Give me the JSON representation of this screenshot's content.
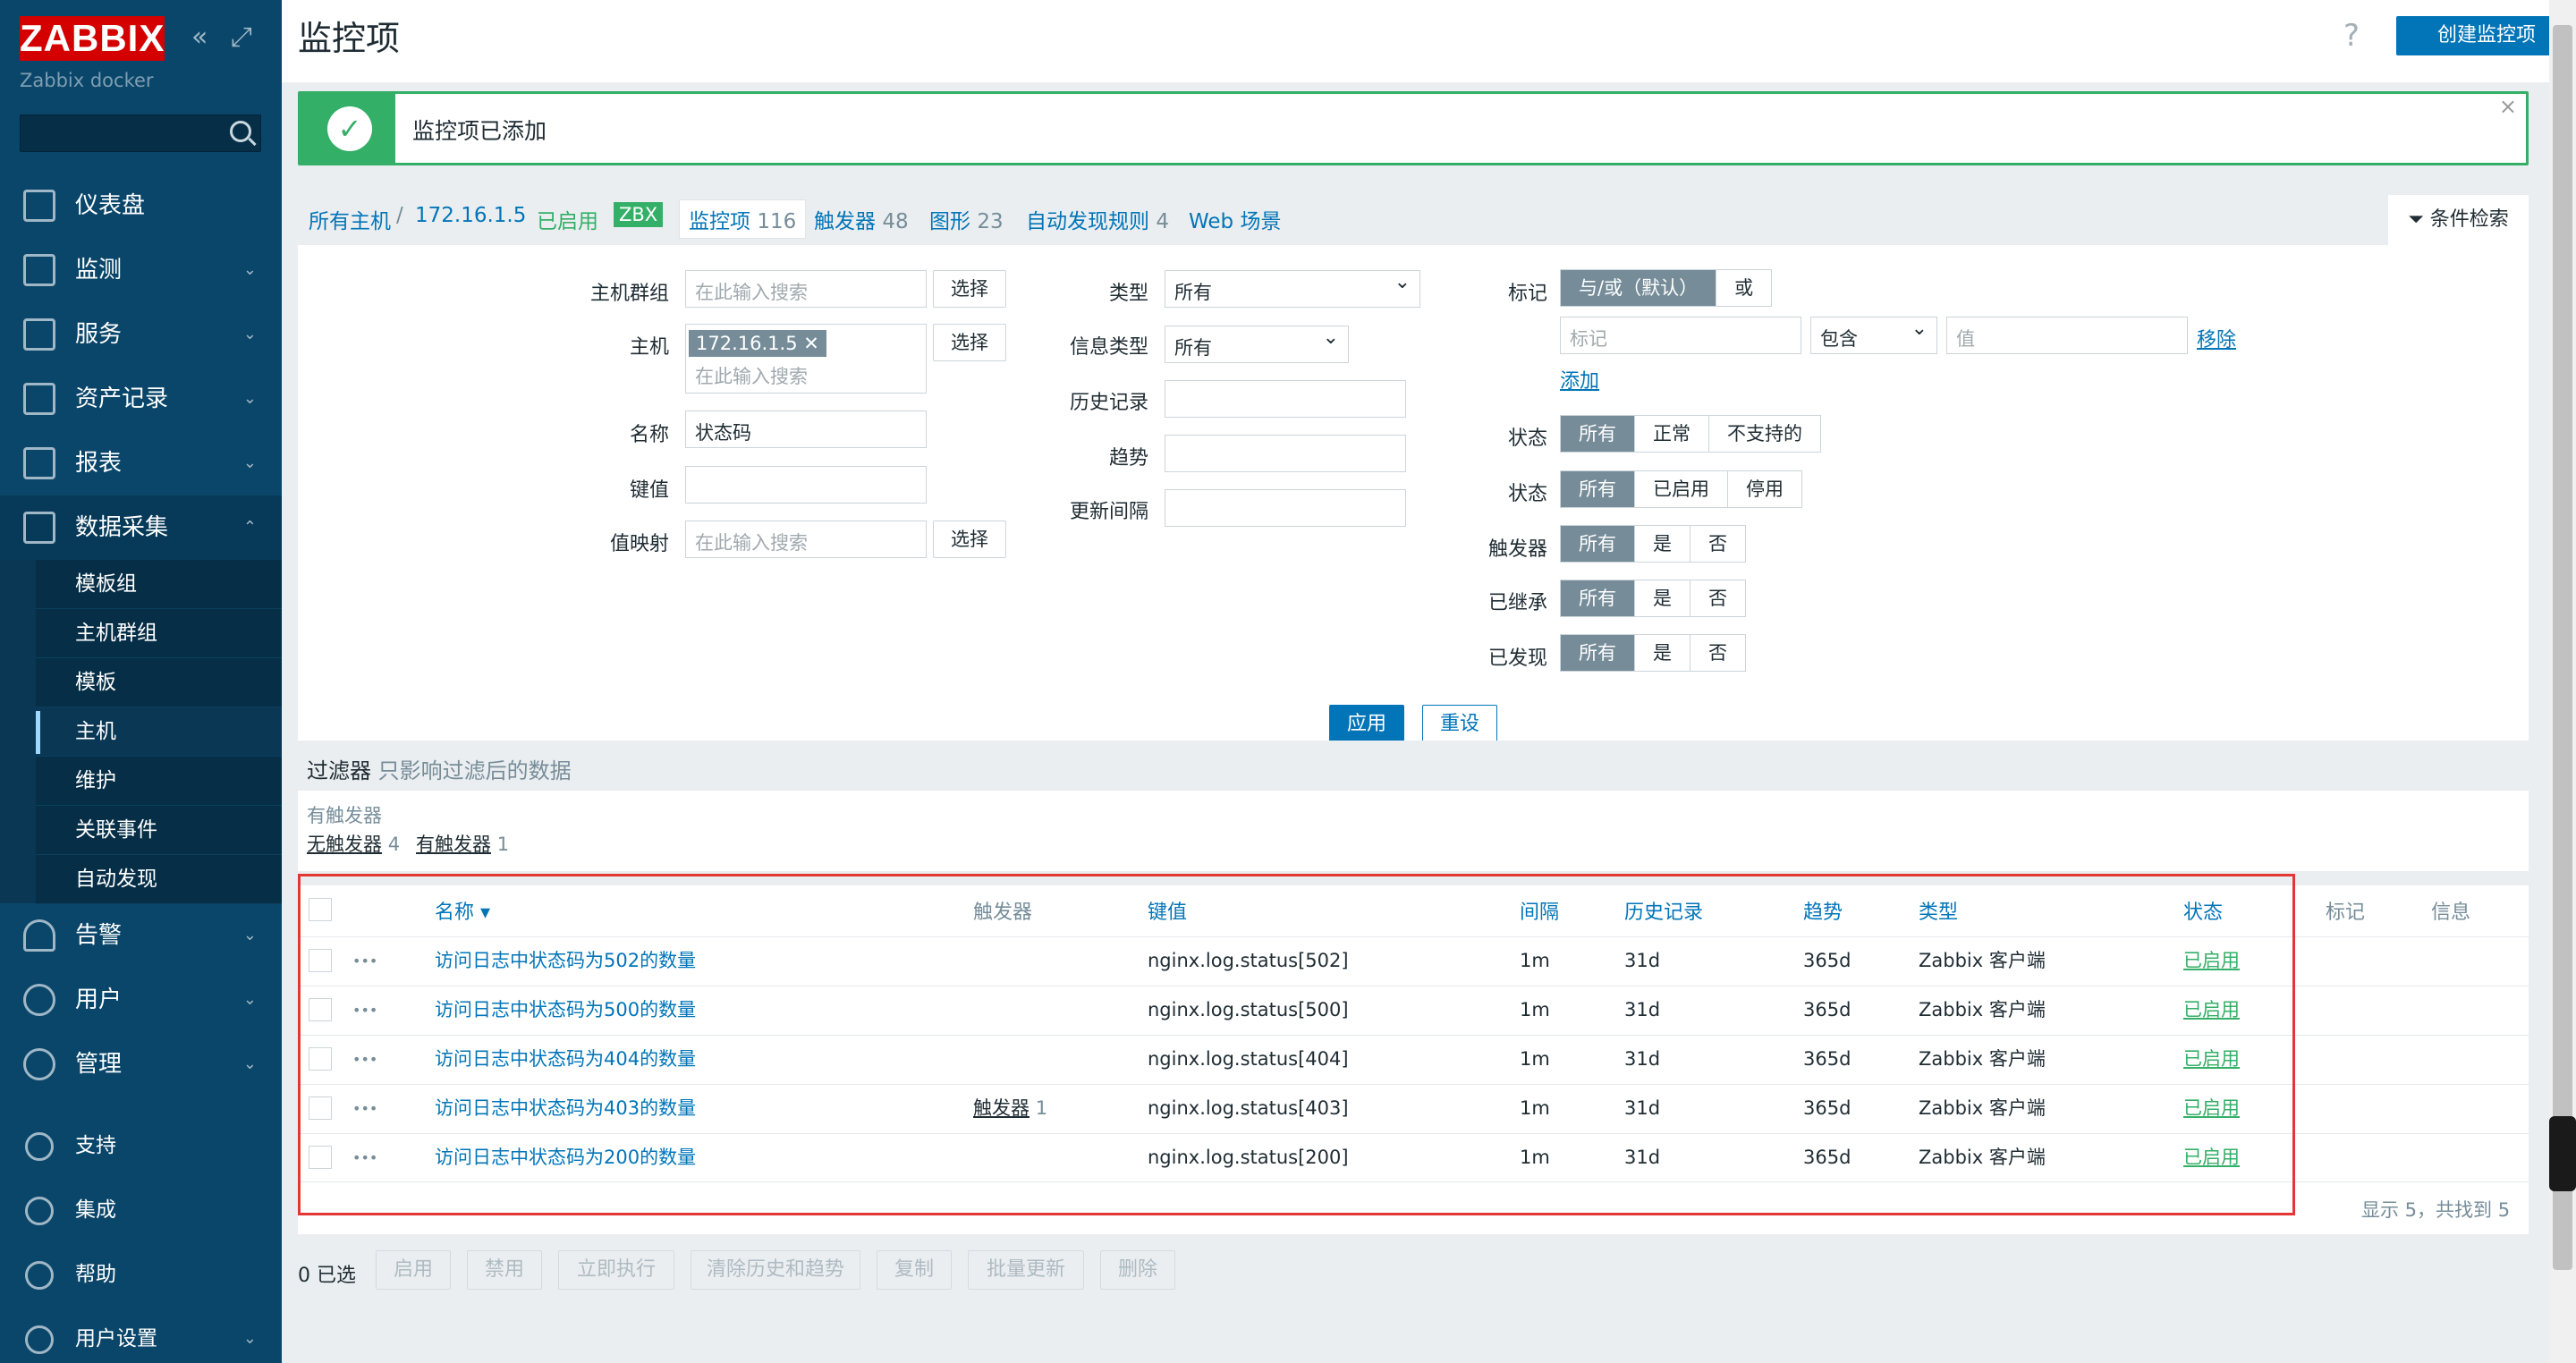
{
  "brand": {
    "logo": "ZABBIX",
    "subtitle": "Zabbix docker"
  },
  "sidebar": {
    "nav": [
      {
        "label": "仪表盘",
        "icon": "dashboard-icon"
      },
      {
        "label": "监测",
        "icon": "monitoring-icon"
      },
      {
        "label": "服务",
        "icon": "services-icon"
      },
      {
        "label": "资产记录",
        "icon": "inventory-icon"
      },
      {
        "label": "报表",
        "icon": "reports-icon"
      },
      {
        "label": "数据采集",
        "icon": "data-collection-icon"
      }
    ],
    "sub": [
      "模板组",
      "主机群组",
      "模板",
      "主机",
      "维护",
      "关联事件",
      "自动发现"
    ],
    "nav_bottom": [
      {
        "label": "告警"
      },
      {
        "label": "用户"
      },
      {
        "label": "管理"
      }
    ],
    "footer": [
      {
        "label": "支持"
      },
      {
        "label": "集成"
      },
      {
        "label": "帮助"
      },
      {
        "label": "用户设置"
      }
    ]
  },
  "header": {
    "title": "监控项",
    "help": "?",
    "create": "创建监控项"
  },
  "message": {
    "text": "监控项已添加"
  },
  "tabs": {
    "all_hosts": "所有主机",
    "sep": "/",
    "host": "172.16.1.5",
    "enabled": "已启用",
    "zbx": "ZBX",
    "items": "监控项",
    "items_count": "116",
    "triggers": "触发器",
    "triggers_count": "48",
    "graphs": "图形",
    "graphs_count": "23",
    "discovery": "自动发现规则",
    "discovery_count": "4",
    "web": "Web 场景",
    "filter_tab": "条件检索"
  },
  "filter": {
    "host_group_label": "主机群组",
    "host_group_ph": "在此输入搜索",
    "select": "选择",
    "host_label": "主机",
    "host_chip": "172.16.1.5",
    "host_ph": "在此输入搜索",
    "name_label": "名称",
    "name_value": "状态码",
    "key_label": "键值",
    "valuemap_label": "值映射",
    "valuemap_ph": "在此输入搜索",
    "type_label": "类型",
    "type_value": "所有",
    "infotype_label": "信息类型",
    "infotype_value": "所有",
    "history_label": "历史记录",
    "trends_label": "趋势",
    "interval_label": "更新间隔",
    "tags_label": "标记",
    "andor": "与/或（默认）",
    "or": "或",
    "tag_ph": "标记",
    "contains": "包含",
    "value_ph": "值",
    "remove": "移除",
    "add": "添加",
    "state_label": "状态",
    "state": [
      "所有",
      "正常",
      "不支持的"
    ],
    "status_label": "状态",
    "status": [
      "所有",
      "已启用",
      "停用"
    ],
    "triggers_label": "触发器",
    "inherited_label": "已继承",
    "discovered_label": "已发现",
    "yn": [
      "所有",
      "是",
      "否"
    ],
    "apply": "应用",
    "reset": "重设"
  },
  "subfilter": {
    "title": "过滤器",
    "hint": "只影响过滤后的数据",
    "group": "有触发器",
    "no_trig": "无触发器",
    "no_trig_n": "4",
    "has_trig": "有触发器",
    "has_trig_n": "1"
  },
  "table": {
    "headers": {
      "name": "名称 ▾",
      "triggers": "触发器",
      "key": "键值",
      "interval": "间隔",
      "history": "历史记录",
      "trends": "趋势",
      "type": "类型",
      "status": "状态",
      "tags": "标记",
      "info": "信息"
    },
    "rows": [
      {
        "name": "访问日志中状态码为502的数量",
        "trig": "",
        "trig_n": "",
        "key": "nginx.log.status[502]",
        "interval": "1m",
        "history": "31d",
        "trends": "365d",
        "type": "Zabbix 客户端",
        "status": "已启用"
      },
      {
        "name": "访问日志中状态码为500的数量",
        "trig": "",
        "trig_n": "",
        "key": "nginx.log.status[500]",
        "interval": "1m",
        "history": "31d",
        "trends": "365d",
        "type": "Zabbix 客户端",
        "status": "已启用"
      },
      {
        "name": "访问日志中状态码为404的数量",
        "trig": "",
        "trig_n": "",
        "key": "nginx.log.status[404]",
        "interval": "1m",
        "history": "31d",
        "trends": "365d",
        "type": "Zabbix 客户端",
        "status": "已启用"
      },
      {
        "name": "访问日志中状态码为403的数量",
        "trig": "触发器",
        "trig_n": "1",
        "key": "nginx.log.status[403]",
        "interval": "1m",
        "history": "31d",
        "trends": "365d",
        "type": "Zabbix 客户端",
        "status": "已启用"
      },
      {
        "name": "访问日志中状态码为200的数量",
        "trig": "",
        "trig_n": "",
        "key": "nginx.log.status[200]",
        "interval": "1m",
        "history": "31d",
        "trends": "365d",
        "type": "Zabbix 客户端",
        "status": "已启用"
      }
    ],
    "summary": "显示 5，共找到 5"
  },
  "actions": {
    "selected": "0 已选",
    "buttons": [
      "启用",
      "禁用",
      "立即执行",
      "清除历史和趋势",
      "复制",
      "批量更新",
      "删除"
    ]
  }
}
